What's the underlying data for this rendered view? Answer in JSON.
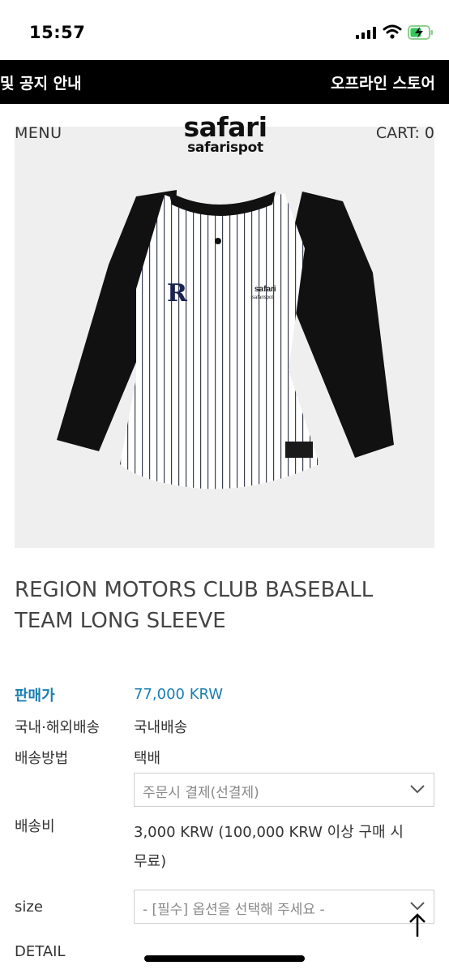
{
  "status_bar": {
    "time": "15:57"
  },
  "banner": {
    "left_text": "및 공지 안내",
    "right_text": "오프라인 스토어"
  },
  "header": {
    "menu": "MENU",
    "logo_line1": "safari",
    "logo_line2": "safarispot",
    "cart": "CART: 0"
  },
  "product": {
    "image_alt": "white pinstripe baseball tee with black raglan sleeves",
    "title": "REGION MOTORS CLUB BASEBALL TEAM LONG SLEEVE",
    "shirt_print": {
      "emblem": "R",
      "brand_top": "safari",
      "brand_bottom": "safarispot"
    }
  },
  "info": {
    "price_label": "판매가",
    "price_value": "77,000 KRW",
    "shipping_region_label": "국내·해외배송",
    "shipping_region_value": "국내배송",
    "shipping_method_label": "배송방법",
    "shipping_method_value": "택배",
    "payment_select": "주문시 결제(선결제)",
    "shipping_fee_label": "배송비",
    "shipping_fee_line1": "3,000 KRW (100,000 KRW 이상 구매 시",
    "shipping_fee_line2": "무료)",
    "size_label": "size",
    "size_select": "- [필수] 옵션을 선택해 주세요 -",
    "detail_label": "DETAIL"
  },
  "colors": {
    "price": "#1a7fb0",
    "banner_bg": "#000000",
    "image_bg": "#efefef"
  }
}
